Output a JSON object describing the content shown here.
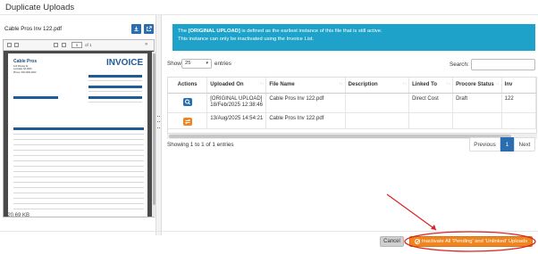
{
  "dialog": {
    "title": "Duplicate Uploads"
  },
  "left_pane": {
    "file_name": "Cable Pros Inv 122.pdf",
    "file_size": "620.69 KB",
    "download_icon": "download-icon",
    "open_external_icon": "external-link-icon",
    "viewer": {
      "page_number": "1",
      "page_of": "of 1",
      "invoice": {
        "company": "Cable Pros",
        "address_lines": [
          "123 Montay St",
          "Lonsdale GA 0000",
          "Phone: 000 0000-0000"
        ],
        "title": "INVOICE"
      }
    }
  },
  "info_box": {
    "line1_prefix": "The ",
    "line1_bold": "[ORIGINAL UPLOAD]",
    "line1_suffix": " is defined as the earliest instance of this file that is still active.",
    "line2": "This instance can only be inactivated using the Invoice List."
  },
  "table_controls": {
    "show_label": "Show",
    "page_size": "25",
    "entries_label": "entries",
    "search_label": "Search:",
    "search_value": ""
  },
  "table": {
    "columns": [
      "Actions",
      "Uploaded On",
      "File Name",
      "Description",
      "Linked To",
      "Procore Status",
      "Inv"
    ],
    "rows": [
      {
        "action_icon": "search-icon",
        "uploaded_line1": "[ORIGINAL UPLOAD]",
        "uploaded_line2": "18/Feb/2025 12:38:46",
        "file_name": "Cable Pros Inv 122.pdf",
        "description": "",
        "linked_to": "Direct Cost",
        "procore_status": "Draft",
        "inv": "122"
      },
      {
        "action_icon": "swap-icon",
        "uploaded_line1": "13/Aug/2025 14:54:21",
        "uploaded_line2": "",
        "file_name": "Cable Pros Inv 122.pdf",
        "description": "",
        "linked_to": "",
        "procore_status": "",
        "inv": ""
      }
    ]
  },
  "pagination": {
    "summary": "Showing 1 to 1 of 1 entries",
    "previous": "Previous",
    "current": "1",
    "next": "Next"
  },
  "footer": {
    "cancel_label": "Cancel",
    "inactivate_label": "Inactivate All 'Pending' and 'Unlinked' Uploads"
  },
  "colors": {
    "primary_blue": "#2a6db0",
    "info_cyan": "#1fa2c9",
    "warning_orange": "#f0851f",
    "annotation_red": "#e02020"
  }
}
